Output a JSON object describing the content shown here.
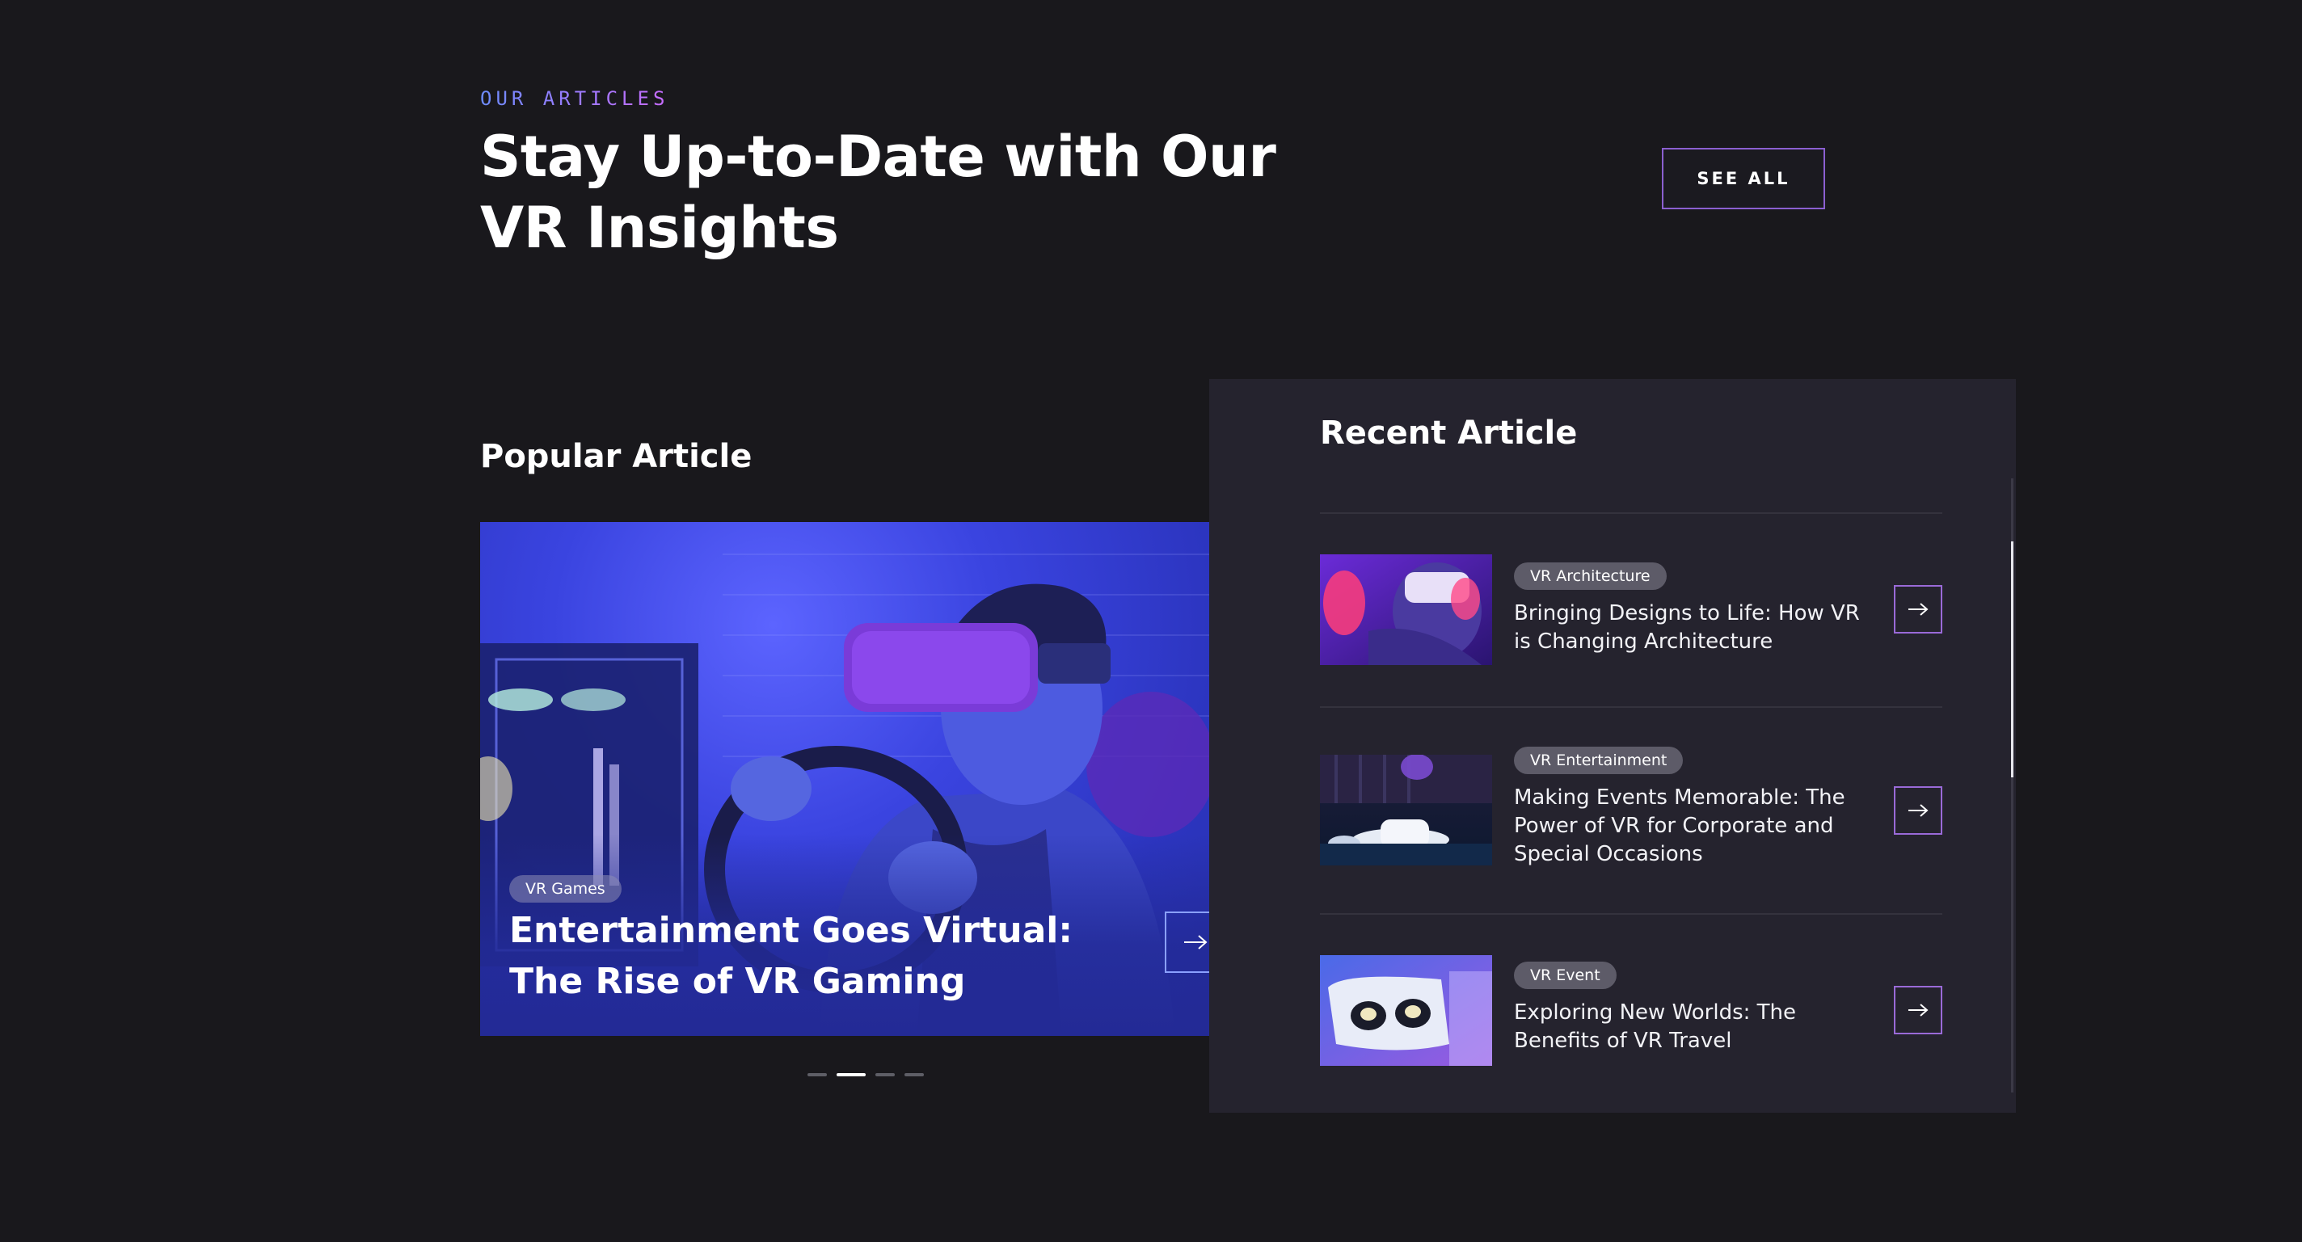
{
  "header": {
    "eyebrow": "OUR ARTICLES",
    "headline": "Stay Up-to-Date with Our VR Insights",
    "see_all_label": "SEE ALL"
  },
  "popular": {
    "title": "Popular Article",
    "card": {
      "tag": "VR Games",
      "title": "Entertainment Goes Virtual: The Rise of VR Gaming",
      "image": "person-vr-headset-racing-wheel"
    },
    "carousel": {
      "slides": 4,
      "active_index": 1
    }
  },
  "recent": {
    "title": "Recent Article",
    "items": [
      {
        "tag": "VR Architecture",
        "title": "Bringing Designs to Life: How VR is Changing Architecture",
        "image": "person-vr-headset-pink"
      },
      {
        "tag": "VR Entertainment",
        "title": "Making Events Memorable: The Power of VR for Corporate and Special Occasions",
        "image": "vr-headset-on-table"
      },
      {
        "tag": "VR Event",
        "title": "Exploring New Worlds: The Benefits of VR Travel",
        "image": "vr-goggles-closeup"
      }
    ]
  },
  "colors": {
    "background": "#19181c",
    "panel": "#25232e",
    "accent_blue": "#6d8cff",
    "accent_purple": "#9a6ad8",
    "tag_bg": "#5d5b68"
  }
}
